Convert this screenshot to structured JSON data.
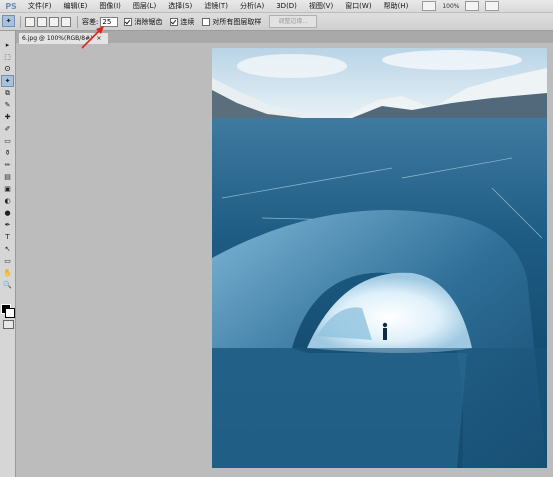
{
  "app": {
    "logo": "PS"
  },
  "menubar": {
    "items": [
      "文件(F)",
      "编辑(E)",
      "图像(I)",
      "图层(L)",
      "选择(S)",
      "滤镜(T)",
      "分析(A)",
      "3D(D)",
      "视图(V)",
      "窗口(W)",
      "帮助(H)"
    ],
    "zoom": "100%"
  },
  "options": {
    "tolerance_label": "容差:",
    "tolerance_value": "25",
    "antialias_label": "消除锯齿",
    "antialias_checked": true,
    "contiguous_label": "连续",
    "contiguous_checked": true,
    "sample_all_label": "对所有图层取样",
    "sample_all_checked": false,
    "refine_edge_label": "调整边缘..."
  },
  "document": {
    "tab_title": "6.jpg @ 100%(RGB/8#)",
    "close_glyph": "×"
  },
  "tools": [
    "▸",
    "⬚",
    "ʘ",
    "✦",
    "⧉",
    "✎",
    "✚",
    "✐",
    "▭",
    "⚱",
    "✏",
    "▤",
    "▣",
    "◐",
    "●",
    "✒",
    "T",
    "↖",
    "▭",
    "✋",
    "🔍"
  ],
  "colors": {
    "accent": "#6f8fb3",
    "annotation": "#e0241b",
    "fg": "#000000",
    "bg": "#ffffff"
  }
}
